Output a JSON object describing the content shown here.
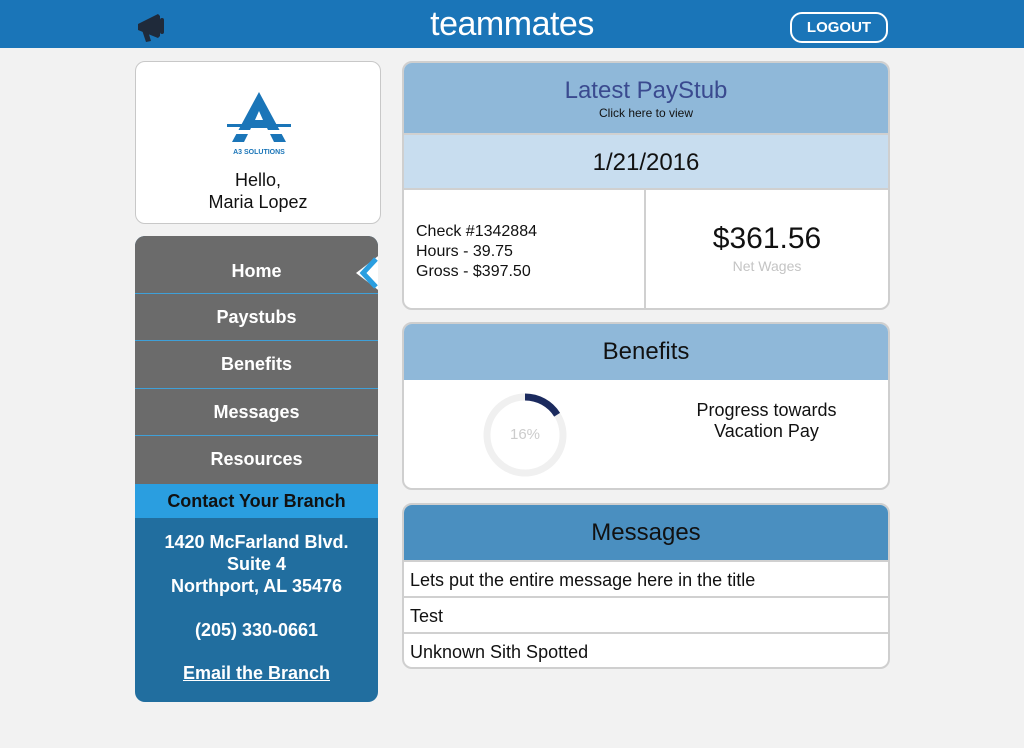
{
  "header": {
    "brand": "teammates",
    "logout_label": "LOGOUT",
    "megaphone_icon": "megaphone-icon",
    "bg_color": "#1a75b8"
  },
  "profile": {
    "company_logo_text": "A3 SOLUTIONS",
    "greeting": "Hello,",
    "name": "Maria Lopez"
  },
  "nav": {
    "items": [
      {
        "label": "Home",
        "active": true
      },
      {
        "label": "Paystubs"
      },
      {
        "label": "Benefits"
      },
      {
        "label": "Messages"
      },
      {
        "label": "Resources"
      }
    ],
    "active_icon": "chevron-left-icon"
  },
  "contact": {
    "heading": "Contact Your Branch",
    "address_line1": "1420 McFarland Blvd.",
    "address_line2": "Suite 4",
    "address_line3": "Northport, AL 35476",
    "phone": "(205) 330-0661",
    "email_link": "Email the Branch"
  },
  "paystub": {
    "title": "Latest PayStub",
    "subtitle": "Click here to view",
    "date": "1/21/2016",
    "check": "Check #1342884",
    "hours": "Hours - 39.75",
    "gross": "Gross - $397.50",
    "net_amount": "$361.56",
    "net_label": "Net Wages"
  },
  "benefits": {
    "title": "Benefits",
    "progress_label": "16%",
    "progress_value": 0.16,
    "progress_text_line1": "Progress towards",
    "progress_text_line2": "Vacation Pay",
    "ring_color": "#1b2a5e",
    "track_color": "#f0f0f0"
  },
  "messages": {
    "title": "Messages",
    "items": [
      "Lets put the entire message here in the title",
      "Test",
      "Unknown Sith Spotted"
    ]
  }
}
